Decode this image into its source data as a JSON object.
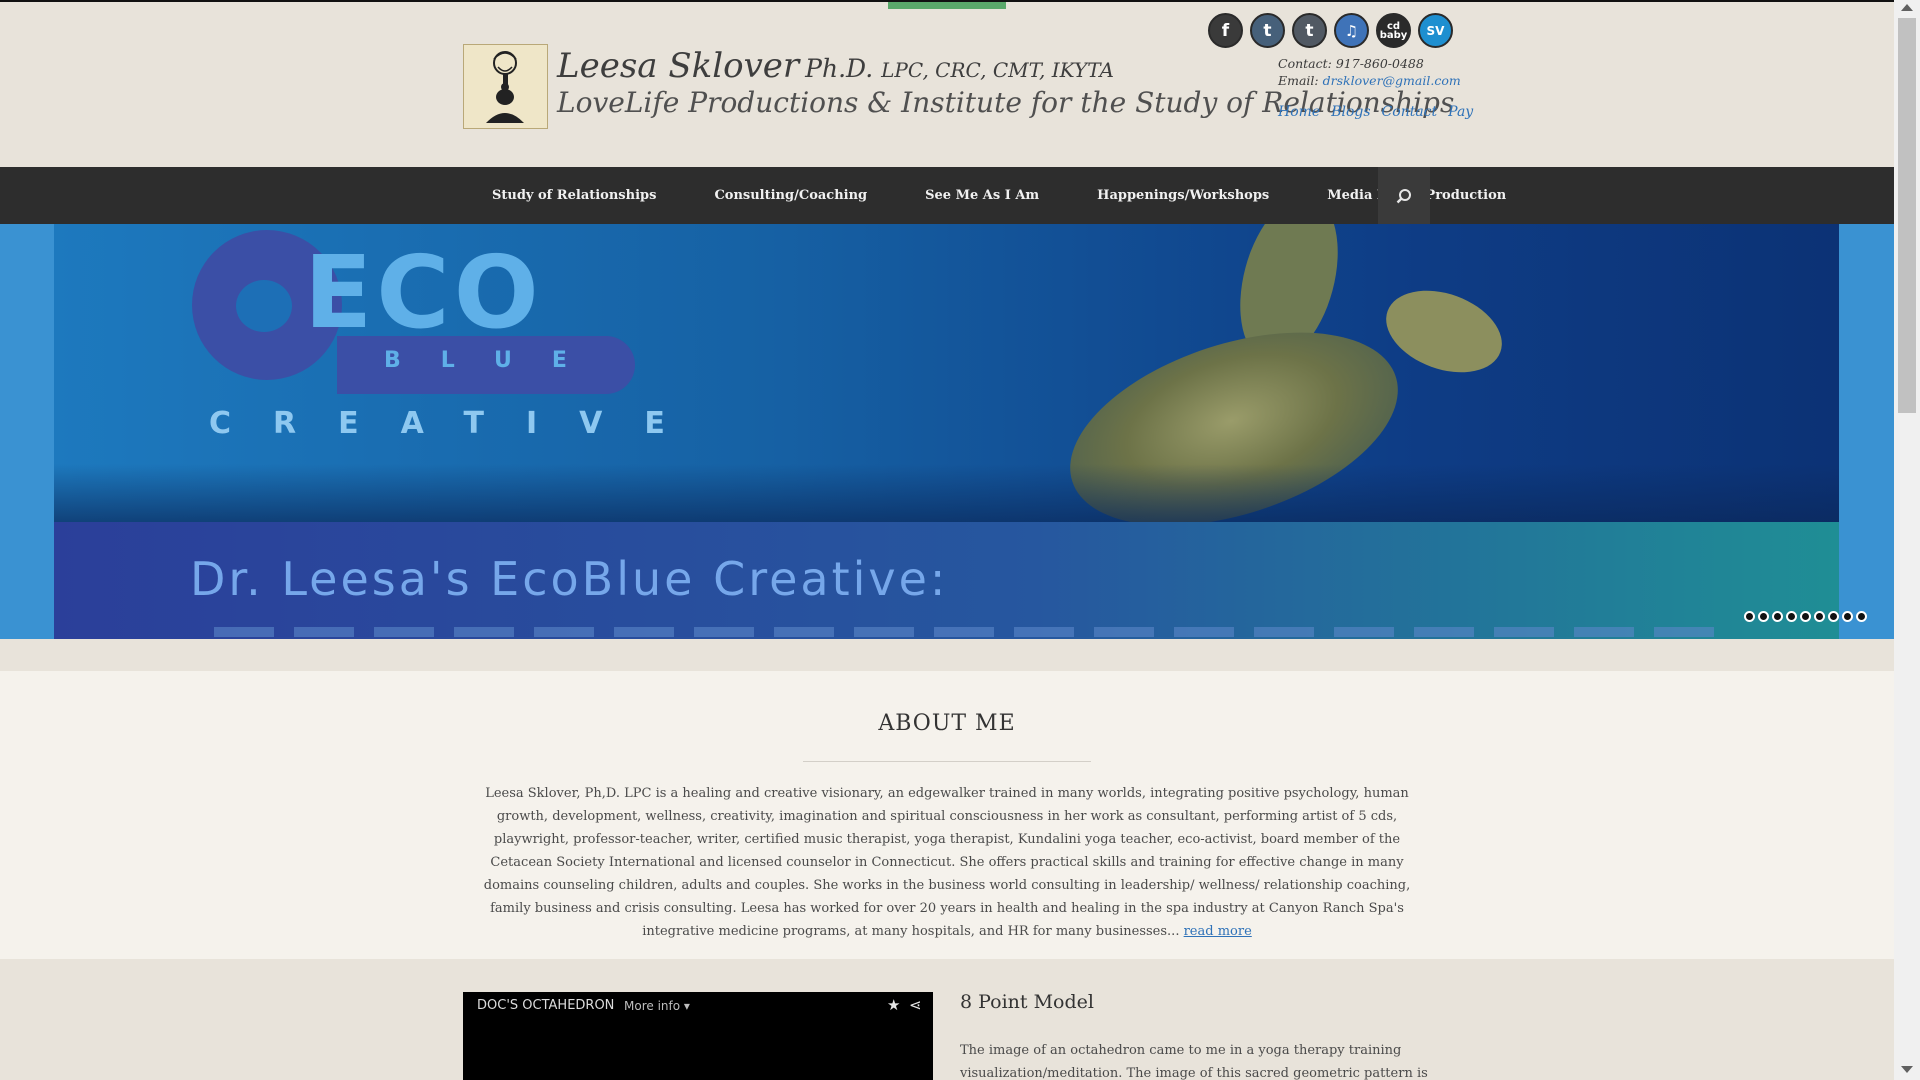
{
  "header": {
    "name": "Leesa Sklover",
    "degree": "Ph.D.",
    "credentials": "LPC, CRC, CMT, IKYTA",
    "subtitle": "LoveLife Productions & Institute for the Study of Relationships",
    "contact_label": "Contact:",
    "contact_phone": "917-860-0488",
    "email_label": "Email:",
    "email": "drsklover@gmail.com",
    "top_links": [
      "Home",
      "Blogs",
      "Contact",
      "Pay"
    ],
    "socials": [
      {
        "name": "facebook-icon",
        "glyph": "f"
      },
      {
        "name": "twitter-icon",
        "glyph": "t"
      },
      {
        "name": "tumblr-icon",
        "glyph": "t"
      },
      {
        "name": "itunes-icon",
        "glyph": "♫"
      },
      {
        "name": "cdbaby-icon",
        "glyph": "cd baby"
      },
      {
        "name": "sv-icon",
        "glyph": "SV"
      }
    ]
  },
  "nav": {
    "items": [
      "Study of Relationships",
      "Consulting/Coaching",
      "See Me As I Am",
      "Happenings/Workshops",
      "Media Music Production"
    ],
    "search_icon": "search-icon"
  },
  "hero": {
    "logo_word": "ECO",
    "logo_blue": "BLUE",
    "logo_creative": "CREATIVE",
    "caption": "Dr. Leesa's EcoBlue Creative:",
    "slide_count": 9
  },
  "about": {
    "heading": "ABOUT ME",
    "text": "Leesa Sklover, Ph,D. LPC is a healing and creative visionary, an edgewalker trained in many worlds, integrating positive psychology, human growth, development, wellness, creativity, imagination and spiritual consciousness in her work as consultant, performing artist of 5 cds, playwright, professor-teacher, writer, certified music therapist, yoga therapist, Kundalini yoga teacher, eco-activist, board member of the Cetacean Society International and licensed counselor in Connecticut. She offers practical skills and training for effective change in many domains counseling children, adults and couples. She works in the business world consulting in leadership/ wellness/ relationship coaching, family business and crisis consulting. Leesa has worked for over 20 years in health and healing in the spa industry at Canyon Ranch Spa's integrative medicine programs, at many hospitals, and HR for many businesses... ",
    "read_more": "read more"
  },
  "feature": {
    "video_title": "DOC'S OCTAHEDRON",
    "video_more": "More info ▾",
    "title": "8 Point Model",
    "text": "The image of an octahedron came to me in a yoga therapy training visualization/meditation. The image of this sacred geometric pattern is used in my"
  }
}
